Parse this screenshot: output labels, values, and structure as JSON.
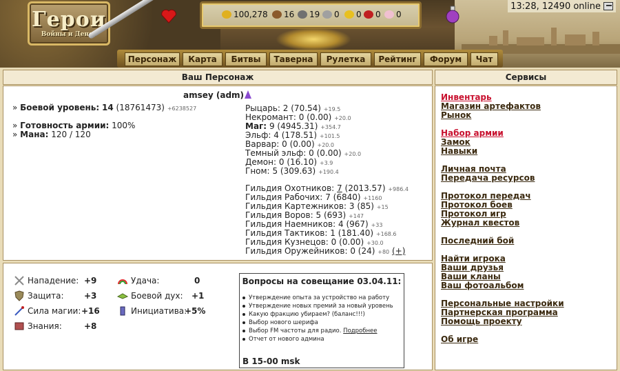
{
  "header": {
    "logo_title": "Герои",
    "logo_subtitle": "Войны и Денег",
    "clock": "13:28, 12490 online",
    "resources": [
      {
        "icon": "gold-icon",
        "value": "100,278",
        "color": "#e0b020"
      },
      {
        "icon": "wood-icon",
        "value": "16",
        "color": "#8b5a2b"
      },
      {
        "icon": "ore-icon",
        "value": "19",
        "color": "#707070"
      },
      {
        "icon": "mercury-icon",
        "value": "0",
        "color": "#a0a0a0"
      },
      {
        "icon": "sulfur-icon",
        "value": "0",
        "color": "#e8c020"
      },
      {
        "icon": "crystal-icon",
        "value": "0",
        "color": "#c02020"
      },
      {
        "icon": "gems-icon",
        "value": "0",
        "color": "#f0c0d0"
      }
    ],
    "nav": [
      "Персонаж",
      "Карта",
      "Битвы",
      "Таверна",
      "Рулетка",
      "Рейтинг",
      "Форум",
      "Чат"
    ]
  },
  "character": {
    "panel_title": "Ваш Персонаж",
    "name": "amsey (adm)",
    "combat_level_label": "Боевой уровень:",
    "combat_level": "14",
    "combat_exp": "(18761473)",
    "combat_exp_delta": "+6238527",
    "army_ready_label": "Готовность армии:",
    "army_ready": "100%",
    "mana_label": "Мана:",
    "mana": "120 / 120",
    "factions": [
      {
        "label": "Рыцарь:",
        "value": "2 (70.54)",
        "delta": "+19.5",
        "bold": false
      },
      {
        "label": "Некромант:",
        "value": "0 (0.00)",
        "delta": "+20.0",
        "bold": false
      },
      {
        "label": "Маг:",
        "value": "9 (4945.31)",
        "delta": "+354.7",
        "bold": true
      },
      {
        "label": "Эльф:",
        "value": "4 (178.51)",
        "delta": "+101.5",
        "bold": false
      },
      {
        "label": "Варвар:",
        "value": "0 (0.00)",
        "delta": "+20.0",
        "bold": false
      },
      {
        "label": "Темный эльф:",
        "value": "0 (0.00)",
        "delta": "+20.0",
        "bold": false
      },
      {
        "label": "Демон:",
        "value": "0 (16.10)",
        "delta": "+3.9",
        "bold": false
      },
      {
        "label": "Гном:",
        "value": "5 (309.63)",
        "delta": "+190.4",
        "bold": false
      }
    ],
    "guilds": [
      {
        "label": "Гильдия Охотников:",
        "level": "7",
        "points": "(2013.57)",
        "delta": "+986.4",
        "link": true
      },
      {
        "label": "Гильдия Рабочих:",
        "level": "7",
        "points": "(6840)",
        "delta": "+1160",
        "link": false
      },
      {
        "label": "Гильдия Картежников:",
        "level": "3",
        "points": "(85)",
        "delta": "+15",
        "link": false
      },
      {
        "label": "Гильдия Воров:",
        "level": "5",
        "points": "(693)",
        "delta": "+147",
        "link": false
      },
      {
        "label": "Гильдия Наемников:",
        "level": "4",
        "points": "(967)",
        "delta": "+33",
        "link": false
      },
      {
        "label": "Гильдия Тактиков:",
        "level": "1",
        "points": "(181.40)",
        "delta": "+168.6",
        "link": false
      },
      {
        "label": "Гильдия Кузнецов:",
        "level": "0",
        "points": "(0.00)",
        "delta": "+30.0",
        "link": false
      },
      {
        "label": "Гильдия Оружейников:",
        "level": "0",
        "points": "(24)",
        "delta": "+80",
        "link": false
      }
    ],
    "plus_label": "(+)"
  },
  "stats": [
    {
      "icon": "sword-icon",
      "label": "Нападение:",
      "value": "+9"
    },
    {
      "icon": "shield-icon",
      "label": "Защита:",
      "value": "+3"
    },
    {
      "icon": "magic-wand-icon",
      "label": "Сила магии:",
      "value": "+16"
    },
    {
      "icon": "book-icon",
      "label": "Знания:",
      "value": "+8"
    },
    {
      "icon": "rainbow-icon",
      "label": "Удача:",
      "value": "0"
    },
    {
      "icon": "morale-icon",
      "label": "Боевой дух:",
      "value": "+1"
    },
    {
      "icon": "initiative-icon",
      "label": "Инициатива:",
      "value": "+5%"
    }
  ],
  "news": {
    "title": "Вопросы на совещание 03.04.11:",
    "items": [
      "Утверждение опыта за устройство на работу",
      "Утверждение новых премий за новый уровень",
      "Какую фракцию убираем? (баланс!!!)",
      "Выбор нового шерифа",
      "Выбор FM частоты для радио."
    ],
    "more_link": "Подробнее",
    "last_item": "Отчет от нового админа",
    "footer": "В 15-00 msk"
  },
  "services": {
    "title": "Сервисы",
    "items": [
      {
        "label": "Инвентарь",
        "red": true
      },
      {
        "label": "Магазин артефактов",
        "red": false
      },
      {
        "label": "Рынок",
        "red": false
      },
      {
        "label": "Набор армии",
        "red": true
      },
      {
        "label": "Замок",
        "red": false
      },
      {
        "label": "Навыки",
        "red": false
      },
      {
        "label": "Личная почта",
        "red": false
      },
      {
        "label": "Передача ресурсов",
        "red": false
      },
      {
        "label": "Протокол передач",
        "red": false
      },
      {
        "label": "Протокол боев",
        "red": false
      },
      {
        "label": "Протокол игр",
        "red": false
      },
      {
        "label": "Журнал квестов",
        "red": false
      },
      {
        "label": "Последний бой",
        "red": false
      },
      {
        "label": "Найти игрока",
        "red": false
      },
      {
        "label": "Ваши друзья",
        "red": false
      },
      {
        "label": "Ваши кланы",
        "red": false
      },
      {
        "label": "Ваш фотоальбом",
        "red": false
      },
      {
        "label": "Персональные настройки",
        "red": false
      },
      {
        "label": "Партнерская программа",
        "red": false
      },
      {
        "label": "Помощь проекту",
        "red": false
      },
      {
        "label": "Об игре",
        "red": false
      }
    ]
  }
}
